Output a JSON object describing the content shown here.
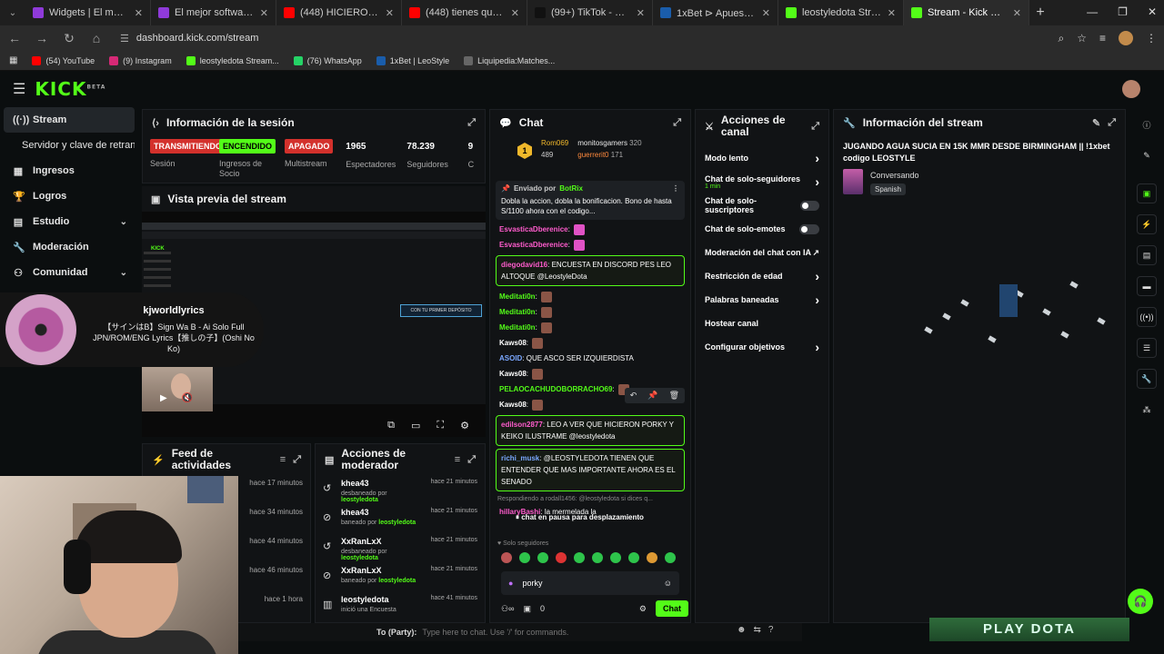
{
  "browser": {
    "tabs": [
      {
        "title": "Widgets | El mejor software",
        "color": "#8f3ad9"
      },
      {
        "title": "El mejor software para po",
        "color": "#8f3ad9"
      },
      {
        "title": "(448) HICIERON la VO",
        "color": "#ff0000"
      },
      {
        "title": "(448) tienes que marcar el",
        "color": "#ff0000"
      },
      {
        "title": "(99+) TikTok - Make Your",
        "color": "#111111"
      },
      {
        "title": "1xBet ⊳ Apuestas deporti",
        "color": "#1a5dab"
      },
      {
        "title": "leostyledota Stream - Wa",
        "color": "#53fc18"
      },
      {
        "title": "Stream - Kick Dashboard",
        "color": "#53fc18",
        "active": true
      }
    ],
    "url": "dashboard.kick.com/stream",
    "bookmarks": [
      {
        "label": "(54) YouTube",
        "color": "#ff0000"
      },
      {
        "label": "(9) Instagram",
        "color": "#d62976"
      },
      {
        "label": "leostyledota Stream...",
        "color": "#53fc18"
      },
      {
        "label": "(76) WhatsApp",
        "color": "#25d366"
      },
      {
        "label": "1xBet | LeoStyle",
        "color": "#1a5dab"
      },
      {
        "label": "Liquipedia:Matches...",
        "color": "#666666"
      }
    ]
  },
  "sidebar": {
    "items": [
      {
        "label": "Stream",
        "icon": "radio-icon",
        "active": true
      },
      {
        "label": "Servidor y clave de retransmisión",
        "sub": true
      },
      {
        "label": "Ingresos",
        "icon": "grid-icon"
      },
      {
        "label": "Logros",
        "icon": "trophy-icon"
      },
      {
        "label": "Estudio",
        "icon": "studio-icon",
        "chevron": true
      },
      {
        "label": "Moderación",
        "icon": "wrench-icon"
      },
      {
        "label": "Comunidad",
        "icon": "community-icon",
        "chevron": true
      }
    ]
  },
  "session": {
    "title": "Información de la sesión",
    "stats": [
      {
        "value": "TRANSMITIENDO",
        "label": "Sesión",
        "kind": "red"
      },
      {
        "value": "ENCENDIDO",
        "label": "Ingresos de Socio",
        "kind": "green"
      },
      {
        "value": "APAGADO",
        "label": "Multistream",
        "kind": "red"
      },
      {
        "value": "1965",
        "label": "Espectadores",
        "kind": "num"
      },
      {
        "value": "78.239",
        "label": "Seguidores",
        "kind": "num"
      },
      {
        "value": "9",
        "label": "C",
        "kind": "num"
      }
    ]
  },
  "preview": {
    "title": "Vista previa del stream",
    "banner": "CON TU PRIMER DEPÓSITO",
    "mini_logo": "KICK"
  },
  "now_playing": {
    "artist": "kjworldlyrics",
    "song": "【サインはB】Sign Wa B - Ai Solo Full JPN/ROM/ENG Lyrics【推しの子】(Oshi No Ko)"
  },
  "feed": {
    "title": "Feed de actividades",
    "rows": [
      {
        "time": "hace 17 minutos"
      },
      {
        "time": "hace 34 minutos"
      },
      {
        "time": "hace 44 minutos"
      },
      {
        "time": "hace 46 minutos"
      },
      {
        "time": "hace 1 hora"
      }
    ]
  },
  "modactions": {
    "title": "Acciones de moderador",
    "rows": [
      {
        "icon": "unban-icon",
        "name": "khea43",
        "action": "desbaneado por",
        "by": "leostyledota",
        "time": "hace 21 minutos"
      },
      {
        "icon": "ban-icon",
        "name": "khea43",
        "action": "baneado por",
        "by": "leostyledota",
        "time": "hace 21 minutos"
      },
      {
        "icon": "unban-icon",
        "name": "XxRanLxX",
        "action": "desbaneado por",
        "by": "leostyledota",
        "time": "hace 21 minutos"
      },
      {
        "icon": "ban-icon",
        "name": "XxRanLxX",
        "action": "baneado por",
        "by": "leostyledota",
        "time": "hace 21 minutos"
      },
      {
        "icon": "poll-icon",
        "name": "leostyledota",
        "action": "inició una Encuesta",
        "by": "",
        "time": "hace 41 minutos"
      }
    ]
  },
  "chat": {
    "title": "Chat",
    "top": [
      {
        "name": "Rom069",
        "count": "489"
      },
      {
        "name": "monitosgamers",
        "count": "320"
      },
      {
        "name": "guerrerit0",
        "count": "171"
      }
    ],
    "top_badge": "1",
    "pinned": {
      "header": "Enviado por",
      "bot": "BotRix",
      "text": "Dobla la accion, dobla la bonificacion. Bono de hasta S/1100 ahora con el codigo..."
    },
    "messages": [
      {
        "user": "EsvasticaDberenice",
        "color": "#ff5ccd",
        "text": "",
        "emote": true
      },
      {
        "user": "EsvasticaDberenice",
        "color": "#ff5ccd",
        "text": "",
        "emote": true
      },
      {
        "user": "diegodavid16",
        "color": "#ff5ccd",
        "text": "ENCUESTA EN DISCORD PES LEO ALTOQUE",
        "tail": "@LeostyleDota",
        "hl": true
      },
      {
        "user": "Meditati0n",
        "color": "#53fc18",
        "text": "",
        "emote": true
      },
      {
        "user": "Meditati0n",
        "color": "#53fc18",
        "text": "",
        "emote": true
      },
      {
        "user": "Meditati0n",
        "color": "#53fc18",
        "text": "",
        "emote": true
      },
      {
        "user": "Kaws08",
        "color": "#ffffff",
        "text": "",
        "emote": true
      },
      {
        "user": "ASOID",
        "color": "#7aa7ff",
        "text": "QUE ASCO SER IZQUIERDISTA"
      },
      {
        "user": "Kaws08",
        "color": "#ffffff",
        "text": "",
        "emote": true
      },
      {
        "user": "PELAOCACHUDOBORRACHO69",
        "color": "#53fc18",
        "text": "",
        "emote": true
      },
      {
        "user": "Kaws08",
        "color": "#ffffff",
        "text": "",
        "emote": true
      },
      {
        "user": "edilson2877",
        "color": "#ff5ccd",
        "text": "LEO A VER QUE HICIERON PORKY Y KEIKO ILUSTRAME @leostyledota",
        "hl": true
      },
      {
        "user": "richi_musk",
        "color": "#7aa7ff",
        "text": "@LEOSTYLEDOTA TIENEN QUE ENTENDER QUE MAS IMPORTANTE AHORA ES EL SENADO",
        "hl": true
      }
    ],
    "reply": "Respondiendo a rodall1456: @leostyledota si dices q...",
    "reply_msg": {
      "user": "hillaryBashi",
      "text": "la mermelada la"
    },
    "paused": "chat en pausa para desplazamiento",
    "followers_only": "Solo seguidores",
    "input_value": "porky",
    "send_label": "Chat",
    "points": "0"
  },
  "channel_actions": {
    "title": "Acciones de canal",
    "items": [
      {
        "label": "Modo lento",
        "control": "chevron"
      },
      {
        "label": "Chat de solo-seguidores",
        "sub": "1 min",
        "control": "chevron"
      },
      {
        "label": "Chat de solo-suscriptores",
        "control": "toggle"
      },
      {
        "label": "Chat de solo-emotes",
        "control": "toggle"
      },
      {
        "label": "Moderación del chat con IA",
        "control": "external"
      },
      {
        "label": "Restricción de edad",
        "control": "chevron"
      },
      {
        "label": "Palabras baneadas",
        "control": "chevron"
      },
      {
        "label": "Hostear canal",
        "control": "none"
      },
      {
        "label": "Configurar objetivos",
        "control": "chevron"
      }
    ]
  },
  "stream_info": {
    "title": "Información del stream",
    "stream_title": "JUGANDO AGUA SUCIA EN 15K MMR DESDE BIRMINGHAM || !1xbet codigo LEOSTYLE",
    "category": "Conversando",
    "language": "Spanish"
  },
  "game_overlay": {
    "party_label": "To (Party):",
    "party_placeholder": "Type here to chat. Use '/' for commands.",
    "play_button": "PLAY DOTA"
  },
  "colors": {
    "accent": "#53fc18",
    "live_red": "#d3312c",
    "panel_bg": "#111315"
  }
}
